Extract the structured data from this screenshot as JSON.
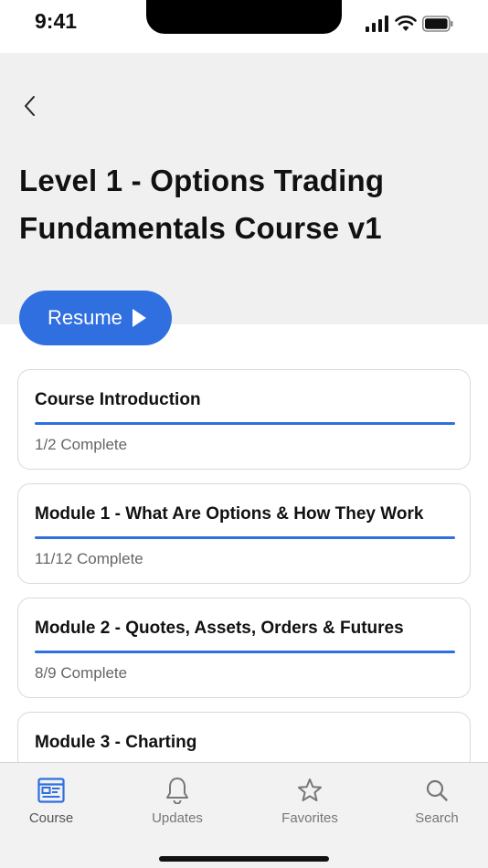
{
  "status_bar": {
    "time": "9:41"
  },
  "header": {
    "title": "Level 1 - Options Trading Fundamentals Course v1",
    "resume_label": "Resume"
  },
  "modules": [
    {
      "title": "Course Introduction",
      "status": "1/2 Complete",
      "progress": 1.0
    },
    {
      "title": "Module 1 - What Are Options & How They Work",
      "status": "11/12 Complete",
      "progress": 1.0
    },
    {
      "title": "Module 2 - Quotes, Assets, Orders & Futures",
      "status": "8/9 Complete",
      "progress": 1.0
    },
    {
      "title": "Module 3 - Charting",
      "status": "",
      "progress": 0
    }
  ],
  "tab_bar": {
    "tabs": [
      {
        "label": "Course",
        "icon": "course-icon",
        "active": true
      },
      {
        "label": "Updates",
        "icon": "bell-icon",
        "active": false
      },
      {
        "label": "Favorites",
        "icon": "star-icon",
        "active": false
      },
      {
        "label": "Search",
        "icon": "search-icon",
        "active": false
      }
    ]
  },
  "colors": {
    "accent": "#2f6fe0",
    "header_bg": "#f0f0f0",
    "tab_bar_bg": "#f2f2f2"
  }
}
